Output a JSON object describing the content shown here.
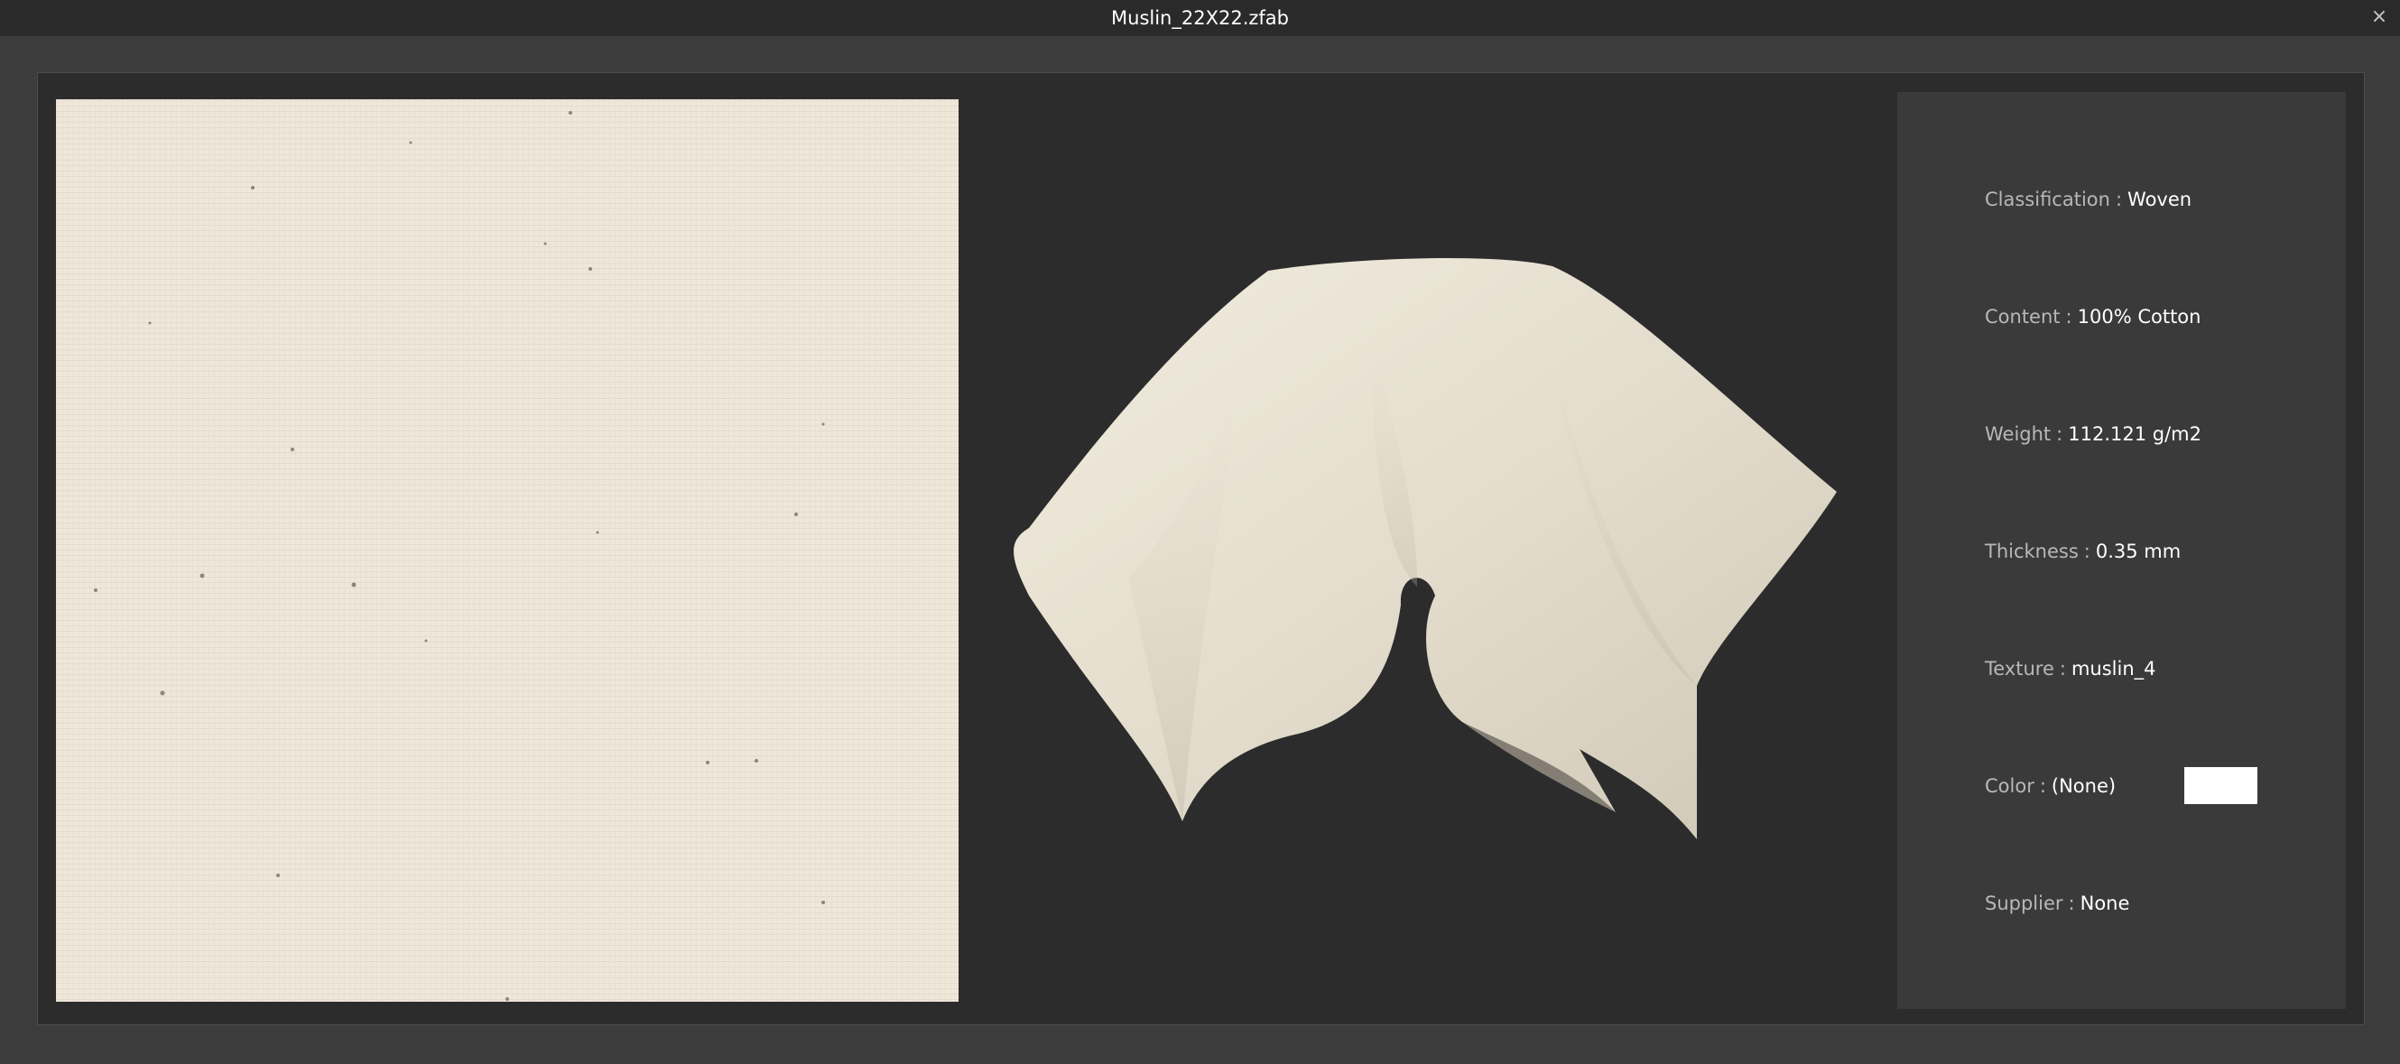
{
  "window": {
    "title": "Muslin_22X22.zfab",
    "close_glyph": "×"
  },
  "properties": {
    "separator": ":",
    "items": [
      {
        "label": "Classification",
        "value": "Woven"
      },
      {
        "label": "Content",
        "value": "100% Cotton"
      },
      {
        "label": "Weight",
        "value": "112.121 g/m2"
      },
      {
        "label": "Thickness",
        "value": "0.35 mm"
      },
      {
        "label": "Texture",
        "value": "muslin_4"
      },
      {
        "label": "Color",
        "value": "(None)"
      },
      {
        "label": "Supplier",
        "value": "None"
      }
    ]
  },
  "colors": {
    "fabric_base": "#efe8da",
    "fabric_shadow": "#c9c2b3",
    "color_chip": "#ffffff"
  },
  "icons": {
    "close": "close-icon"
  }
}
